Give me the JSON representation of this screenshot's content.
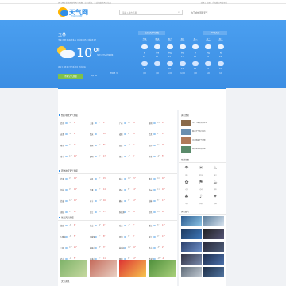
{
  "topbar": {
    "text": "天气网提供全国各地天气预报、空气质量、生活指数等天气信息",
    "links": "登录 | 注册 | 手机版 | 网站导航"
  },
  "header": {
    "logo_text": "天气网",
    "logo_sub": "TIANQI.COM",
    "search_placeholder": "请输入城市名称",
    "links": "热门城市 国际天气"
  },
  "hero": {
    "city": "玉林",
    "sub": "今天 周四 阵雨转多云 日出07:05 日落18:17",
    "temp": "10°",
    "desc": "阴",
    "detail": "湿度:83% 北风2级",
    "meta": "更新于 08:00 空气质量良 紫外线弱",
    "btn": "查看空气质量",
    "stat1": "AQI 58",
    "stat2": "PM2.5 32"
  },
  "forecast": {
    "tab1": "未来7天天气预报",
    "tab2": "15天天气",
    "days": [
      {
        "name": "今天",
        "date": "01/02",
        "weather": "阴",
        "high": "14°",
        "low": "9°",
        "wind": "北风"
      },
      {
        "name": "明天",
        "date": "01/03",
        "weather": "小雨",
        "high": "13°",
        "low": "9°",
        "wind": "北风"
      },
      {
        "name": "周六",
        "date": "01/04",
        "weather": "多云",
        "high": "15°",
        "low": "10°",
        "wind": "东北风"
      },
      {
        "name": "周日",
        "date": "01/05",
        "weather": "多云",
        "high": "17°",
        "low": "11°",
        "wind": "东北风"
      },
      {
        "name": "周一",
        "date": "01/06",
        "weather": "阴",
        "high": "16°",
        "low": "11°",
        "wind": "北风"
      },
      {
        "name": "周二",
        "date": "01/07",
        "weather": "多云",
        "high": "18°",
        "low": "12°",
        "wind": "东风"
      },
      {
        "name": "周三",
        "date": "01/08",
        "weather": "晴",
        "high": "19°",
        "low": "12°",
        "wind": "东风"
      }
    ]
  },
  "sections": {
    "hot": "热门城市天气预报",
    "nearby": "周边地区天气预报",
    "scenic": "景点天气预报",
    "bottom": "天气资讯"
  },
  "cities_hot": [
    [
      {
        "n": "北京",
        "t": "-3°",
        "h": "6°"
      },
      {
        "n": "上海",
        "t": "5°",
        "h": "9°"
      },
      {
        "n": "广州",
        "t": "13°",
        "h": "18°"
      },
      {
        "n": "深圳",
        "t": "14°",
        "h": "19°"
      }
    ],
    [
      {
        "n": "天津",
        "t": "-4°",
        "h": "4°"
      },
      {
        "n": "重庆",
        "t": "7°",
        "h": "10°"
      },
      {
        "n": "成都",
        "t": "4°",
        "h": "10°"
      },
      {
        "n": "武汉",
        "t": "2°",
        "h": "8°"
      }
    ],
    [
      {
        "n": "南京",
        "t": "1°",
        "h": "7°"
      },
      {
        "n": "杭州",
        "t": "3°",
        "h": "8°"
      },
      {
        "n": "西安",
        "t": "-2°",
        "h": "6°"
      },
      {
        "n": "长沙",
        "t": "4°",
        "h": "9°"
      }
    ],
    [
      {
        "n": "南宁",
        "t": "11°",
        "h": "16°"
      },
      {
        "n": "昆明",
        "t": "5°",
        "h": "17°"
      },
      {
        "n": "郑州",
        "t": "-1°",
        "h": "6°"
      },
      {
        "n": "济南",
        "t": "-2°",
        "h": "5°"
      }
    ]
  ],
  "cities_nearby": [
    [
      {
        "n": "北流",
        "t": "9°",
        "h": "14°"
      },
      {
        "n": "容县",
        "t": "9°",
        "h": "15°"
      },
      {
        "n": "陆川",
        "t": "10°",
        "h": "15°"
      },
      {
        "n": "博白",
        "t": "10°",
        "h": "16°"
      }
    ],
    [
      {
        "n": "兴业",
        "t": "9°",
        "h": "14°"
      },
      {
        "n": "贵港",
        "t": "9°",
        "h": "14°"
      },
      {
        "n": "梧州",
        "t": "8°",
        "h": "14°"
      },
      {
        "n": "钦州",
        "t": "11°",
        "h": "16°"
      }
    ],
    [
      {
        "n": "北海",
        "t": "12°",
        "h": "16°"
      },
      {
        "n": "南宁",
        "t": "11°",
        "h": "16°"
      },
      {
        "n": "柳州",
        "t": "7°",
        "h": "12°"
      },
      {
        "n": "桂林",
        "t": "5°",
        "h": "11°"
      }
    ],
    [
      {
        "n": "茂名",
        "t": "11°",
        "h": "17°"
      },
      {
        "n": "湛江",
        "t": "12°",
        "h": "17°"
      },
      {
        "n": "防城港",
        "t": "12°",
        "h": "16°"
      },
      {
        "n": "百色",
        "t": "10°",
        "h": "16°"
      }
    ]
  ],
  "cities_scenic": [
    [
      {
        "n": "故宫",
        "t": "-3°",
        "h": "6°"
      },
      {
        "n": "黄山",
        "t": "-2°",
        "h": "4°"
      },
      {
        "n": "泰山",
        "t": "-6°",
        "h": "2°"
      },
      {
        "n": "漓江",
        "t": "5°",
        "h": "11°"
      }
    ],
    [
      {
        "n": "九寨沟",
        "t": "-5°",
        "h": "5°"
      },
      {
        "n": "张家界",
        "t": "2°",
        "h": "8°"
      },
      {
        "n": "西湖",
        "t": "3°",
        "h": "8°"
      },
      {
        "n": "丽江",
        "t": "0°",
        "h": "13°"
      }
    ],
    [
      {
        "n": "三亚",
        "t": "19°",
        "h": "25°"
      },
      {
        "n": "峨眉山",
        "t": "-3°",
        "h": "3°"
      },
      {
        "n": "鼓浪屿",
        "t": "11°",
        "h": "16°"
      },
      {
        "n": "华山",
        "t": "-5°",
        "h": "2°"
      }
    ],
    [
      {
        "n": "庐山",
        "t": "-1°",
        "h": "5°"
      },
      {
        "n": "武夷山",
        "t": "4°",
        "h": "11°"
      },
      {
        "n": "阳朔",
        "t": "6°",
        "h": "12°"
      },
      {
        "n": "青海湖",
        "t": "-15°",
        "h": "-2°"
      }
    ]
  ],
  "bottom_imgs": [
    "风景",
    "会议",
    "出游",
    "植物"
  ],
  "side": {
    "title1": "天气资讯",
    "news": [
      "冷空气来袭南方降温",
      "春运天气出行提示",
      "北方雾霾天气预警",
      "西南地区将有降雨"
    ],
    "title2": "生活指数",
    "indices": [
      {
        "icon": "☂",
        "label": "雨伞"
      },
      {
        "icon": "☀",
        "label": "紫外线"
      },
      {
        "icon": "♨",
        "label": "感冒"
      },
      {
        "icon": "✿",
        "label": "过敏"
      },
      {
        "icon": "⚑",
        "label": "运动"
      },
      {
        "icon": "☕",
        "label": "洗车"
      },
      {
        "icon": "♣",
        "label": "穿衣"
      },
      {
        "icon": "♪",
        "label": "旅游"
      },
      {
        "icon": "✦",
        "label": "晾晒"
      }
    ],
    "title3": "天气图片"
  },
  "colors": {
    "brand": "#2f8ee8",
    "accent": "#7fc14a",
    "hot": "#e05050"
  }
}
